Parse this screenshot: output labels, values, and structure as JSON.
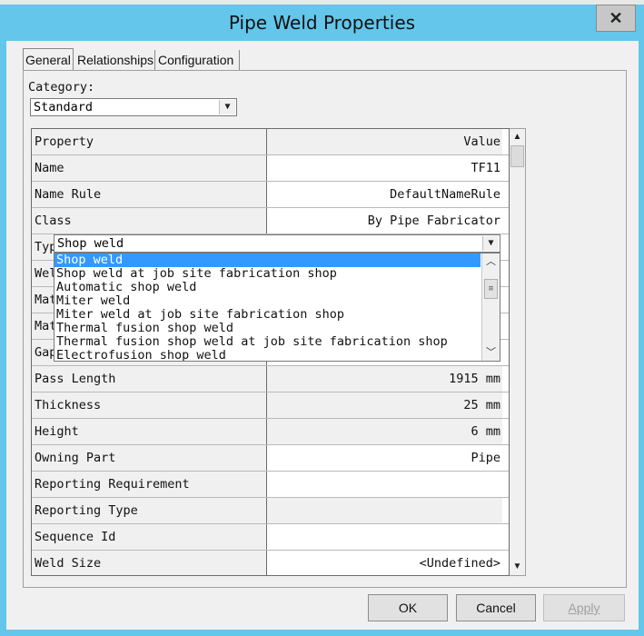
{
  "window": {
    "title": "Pipe Weld Properties",
    "close_glyph": "✕"
  },
  "tabs": [
    {
      "label": "General",
      "active": true
    },
    {
      "label": "Relationships",
      "active": false
    },
    {
      "label": "Configuration",
      "active": false
    }
  ],
  "category": {
    "label": "Category:",
    "value": "Standard"
  },
  "grid": {
    "header": {
      "property": "Property",
      "value": "Value"
    },
    "rows": [
      {
        "name": "Name",
        "value": "TF11"
      },
      {
        "name": "Name Rule",
        "value": "DefaultNameRule"
      },
      {
        "name": "Class",
        "value": "By Pipe Fabricator"
      },
      {
        "name": "Typ",
        "value": ""
      },
      {
        "name": "Wel",
        "value": ""
      },
      {
        "name": "Mat",
        "value": ""
      },
      {
        "name": "Mat",
        "value": ""
      },
      {
        "name": "Gap",
        "value": ""
      },
      {
        "name": "Pass Length",
        "value": "1915 mm"
      },
      {
        "name": "Thickness",
        "value": "25 mm"
      },
      {
        "name": "Height",
        "value": "6 mm"
      },
      {
        "name": "Owning Part",
        "value": "Pipe"
      },
      {
        "name": "Reporting Requirement",
        "value": ""
      },
      {
        "name": "Reporting Type",
        "value": ""
      },
      {
        "name": "Sequence Id",
        "value": ""
      },
      {
        "name": "Weld Size",
        "value": "<Undefined>"
      }
    ]
  },
  "type_dropdown": {
    "value": "Shop weld",
    "options": [
      "Shop weld",
      "Shop weld at job site fabrication shop",
      "Automatic shop weld",
      "Miter weld",
      "Miter weld at job site fabrication shop",
      "Thermal fusion shop weld",
      "Thermal fusion shop weld at job site fabrication shop",
      "Electrofusion shop weld"
    ],
    "selected_index": 0
  },
  "buttons": {
    "ok": "OK",
    "cancel": "Cancel",
    "apply": "Apply"
  }
}
